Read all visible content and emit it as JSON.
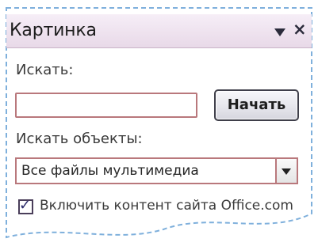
{
  "pane": {
    "title": "Картинка",
    "search_label": "Искать:",
    "search_value": "",
    "go_button": "Начать",
    "objects_label": "Искать объекты:",
    "objects_selected": "Все файлы мультимедиа",
    "include_checkbox_label": "Включить контент сайта Office.com",
    "include_checked": true
  },
  "icons": {
    "menu": "dropdown-triangle-icon",
    "close": "close-icon",
    "select": "chevron-down-icon",
    "check": "checkmark-icon"
  },
  "colors": {
    "titlebar": "#eadbe9",
    "field_border": "#b9787c",
    "dashed_border": "#7fb0dc"
  }
}
